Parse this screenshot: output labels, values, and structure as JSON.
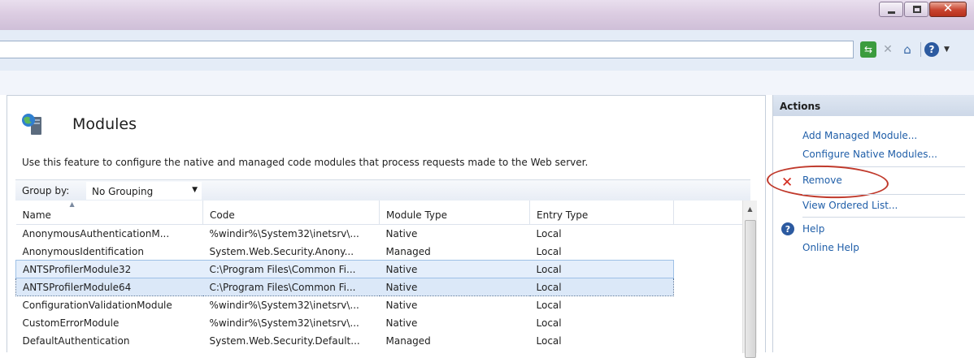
{
  "feature": {
    "title": "Modules",
    "description": "Use this feature to configure the native and managed code modules that process requests made to the Web server."
  },
  "group_by": {
    "label": "Group by:",
    "value": "No Grouping"
  },
  "columns": [
    "Name",
    "Code",
    "Module Type",
    "Entry Type"
  ],
  "rows": [
    {
      "name": "AnonymousAuthenticationM...",
      "code": "%windir%\\System32\\inetsrv\\...",
      "type": "Native",
      "entry": "Local"
    },
    {
      "name": "AnonymousIdentification",
      "code": "System.Web.Security.Anony...",
      "type": "Managed",
      "entry": "Local"
    },
    {
      "name": "ANTSProfilerModule32",
      "code": "C:\\Program Files\\Common Fi...",
      "type": "Native",
      "entry": "Local"
    },
    {
      "name": "ANTSProfilerModule64",
      "code": "C:\\Program Files\\Common Fi...",
      "type": "Native",
      "entry": "Local"
    },
    {
      "name": "ConfigurationValidationModule",
      "code": "%windir%\\System32\\inetsrv\\...",
      "type": "Native",
      "entry": "Local"
    },
    {
      "name": "CustomErrorModule",
      "code": "%windir%\\System32\\inetsrv\\...",
      "type": "Native",
      "entry": "Local"
    },
    {
      "name": "DefaultAuthentication",
      "code": "System.Web.Security.Default...",
      "type": "Managed",
      "entry": "Local"
    }
  ],
  "actions": {
    "header": "Actions",
    "add_managed": "Add Managed Module...",
    "configure_native": "Configure Native Modules...",
    "remove": "Remove",
    "view_ordered": "View Ordered List...",
    "help": "Help",
    "online_help": "Online Help"
  },
  "colors": {
    "link": "#1f5ea8",
    "remove_icon": "#d22b1f",
    "highlight_ellipse": "#c0392b",
    "selection": "#e4eefb"
  }
}
